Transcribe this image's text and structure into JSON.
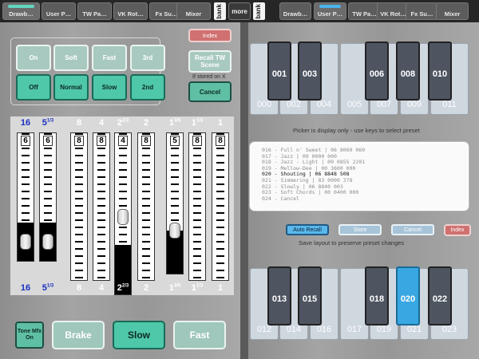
{
  "tabs_left": [
    "Drawb…",
    "User P…",
    "TW Pa…",
    "VK Rot…",
    "Fx Su…",
    "Mixer"
  ],
  "tabs_right": [
    "Drawb…",
    "User P…",
    "TW Pa…",
    "VK Rot…",
    "Fx Su…",
    "Mixer"
  ],
  "bank_label": "bank",
  "more_label": "more",
  "left": {
    "buttons_row1": [
      "On",
      "Soft",
      "Fast",
      "3rd"
    ],
    "buttons_row2": [
      "Off",
      "Normal",
      "Slow",
      "2nd"
    ],
    "index_label": "Index",
    "recall_label": "Recall TW Scene",
    "stored_note": "If stored on X",
    "cancel_label": "Cancel",
    "drawbars": [
      {
        "header": "16",
        "sup": "",
        "value": "6",
        "footer": "16",
        "footer_sup": "",
        "blue": true
      },
      {
        "header": "5",
        "sup": "1/3",
        "value": "6",
        "footer": "5",
        "footer_sup": "1/3",
        "blue": true
      },
      {
        "header": "8",
        "sup": "",
        "value": "8",
        "footer": "8",
        "footer_sup": "",
        "blue": false
      },
      {
        "header": "4",
        "sup": "",
        "value": "8",
        "footer": "4",
        "footer_sup": "",
        "blue": false
      },
      {
        "header": "2",
        "sup": "2/3",
        "value": "4",
        "footer": "2",
        "footer_sup": "2/3",
        "blue": false
      },
      {
        "header": "2",
        "sup": "",
        "value": "8",
        "footer": "2",
        "footer_sup": "",
        "blue": false
      },
      {
        "header": "1",
        "sup": "3/5",
        "value": "5",
        "footer": "1",
        "footer_sup": "3/5",
        "blue": false
      },
      {
        "header": "1",
        "sup": "1/3",
        "value": "8",
        "footer": "1",
        "footer_sup": "1/3",
        "blue": false
      },
      {
        "header": "1",
        "sup": "",
        "value": "8",
        "footer": "1",
        "footer_sup": "",
        "blue": false
      }
    ],
    "tone_label": "Tone Mfx On",
    "brake_label": "Brake",
    "slow_label": "Slow",
    "fast_label": "Fast"
  },
  "right": {
    "top_keys_black": [
      "001",
      "003",
      "006",
      "008",
      "010"
    ],
    "top_keys_white": [
      "000",
      "002",
      "004",
      "005",
      "007",
      "009",
      "011"
    ],
    "picker_note": "Picker is display only - use keys to select preset",
    "presets": [
      "016 - Full n' Sweet | 06 8060 060",
      "017 - Jazz | 00 0000 000",
      "018 - Jazz - Light | 00 0855 2201",
      "019 - Mellow-Dee | 00 3600 000",
      "020 - Shouting | 06 8848 508",
      "021 - Simmering | 83 0000 378",
      "022 - Slowly | 06 8840 003",
      "023 - Soft Chords | 00 0400 000",
      "024 - Cancel"
    ],
    "selected_preset_index": 4,
    "auto_recall_label": "Auto Recall",
    "store_label": "Store",
    "cancel_label": "Cancel",
    "index_label": "Index",
    "save_note": "Save layout to preserve preset changes",
    "bottom_keys_black": [
      "013",
      "015",
      "018",
      "020",
      "022"
    ],
    "bottom_keys_white": [
      "012",
      "014",
      "016",
      "017",
      "019",
      "021",
      "023"
    ],
    "selected_key": "020"
  }
}
